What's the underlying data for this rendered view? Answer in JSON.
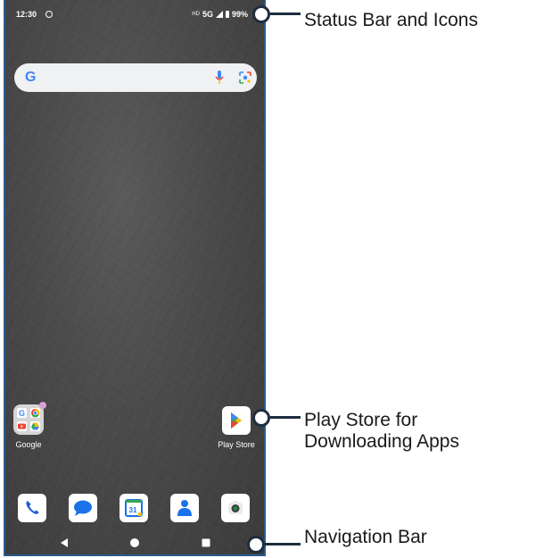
{
  "status_bar": {
    "time": "12:30",
    "hd": "HD",
    "network": "5G",
    "battery": "99%"
  },
  "search_bar": {
    "logo": "G",
    "mic_icon": "microphone-icon",
    "lens_icon": "lens-icon"
  },
  "home_apps": [
    {
      "label": "Google",
      "icon": "google-folder-icon"
    },
    {
      "label": "Play Store",
      "icon": "play-store-icon"
    }
  ],
  "dock": [
    {
      "icon": "phone-icon"
    },
    {
      "icon": "messages-icon"
    },
    {
      "icon": "calendar-icon",
      "text": "31"
    },
    {
      "icon": "contacts-icon"
    },
    {
      "icon": "camera-icon"
    }
  ],
  "nav_bar": [
    "back-icon",
    "home-icon",
    "recents-icon"
  ],
  "callouts": {
    "status": "Status Bar and Icons",
    "play_store_line1": "Play Store for",
    "play_store_line2": "Downloading Apps",
    "navigation": "Navigation Bar"
  },
  "colors": {
    "frame": "#2b5c8f",
    "callout": "#1e2d3f",
    "google_blue": "#4285f4",
    "google_red": "#ea4335",
    "google_yellow": "#fbbc04",
    "google_green": "#34a853"
  }
}
